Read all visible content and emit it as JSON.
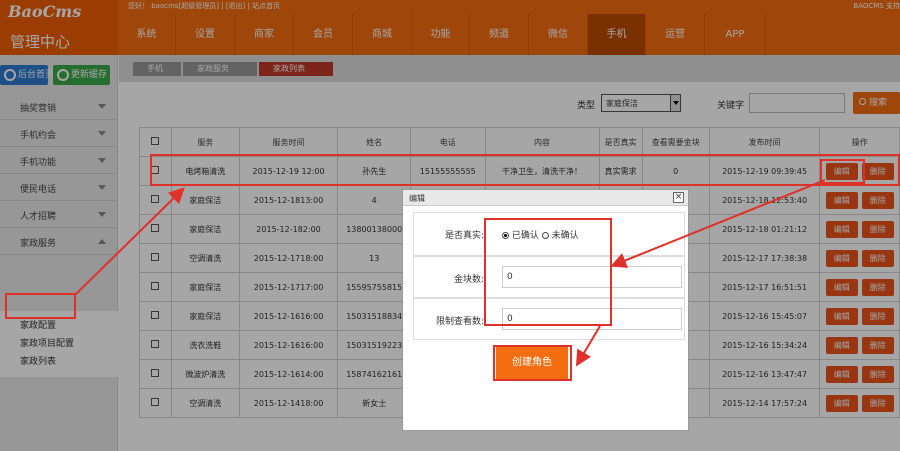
{
  "brand": {
    "logo": "BaoCms",
    "title": "管理中心"
  },
  "top_links": {
    "welcome": "您好！ baocms[超级管理员] | [退出] | 站点首页",
    "support": "BAOCMS 支持"
  },
  "nav": {
    "items": [
      {
        "label": "系统"
      },
      {
        "label": "设置"
      },
      {
        "label": "商家"
      },
      {
        "label": "会员"
      },
      {
        "label": "商城"
      },
      {
        "label": "功能"
      },
      {
        "label": "频道"
      },
      {
        "label": "微信"
      },
      {
        "label": "手机"
      },
      {
        "label": "运营"
      },
      {
        "label": "APP"
      }
    ],
    "active": 8
  },
  "sidebar": {
    "home_button": "后台首页",
    "cache_button": "更新缓存",
    "menu": [
      {
        "label": "抽奖营销"
      },
      {
        "label": "手机约会"
      },
      {
        "label": "手机功能"
      },
      {
        "label": "便民电话"
      },
      {
        "label": "人才招聘"
      },
      {
        "label": "家政服务"
      }
    ],
    "submenu": [
      {
        "label": "家政配置"
      },
      {
        "label": "家政项目配置"
      },
      {
        "label": "家政列表"
      }
    ]
  },
  "breadcrumb": [
    "手机",
    "家政服务",
    "家政列表"
  ],
  "filter": {
    "type_label": "类型",
    "type_value": "家庭保洁",
    "keyword_label": "关键字",
    "search_button": "搜索"
  },
  "table": {
    "headers": [
      "",
      "服务",
      "服务时间",
      "姓名",
      "电话",
      "内容",
      "是否真实",
      "查看需要金块",
      "发布时间",
      "操作"
    ],
    "rows": [
      [
        "电烤箱清洗",
        "2015-12-19 12:00",
        "孙先生",
        "15155555555",
        "干净卫生，清洗干净！",
        "真实需求",
        "0",
        "2015-12-19 09:39:45"
      ],
      [
        "家庭保洁",
        "2015-12-1813:00",
        "4",
        "",
        "",
        "",
        "",
        "2015-12-18 12:53:40"
      ],
      [
        "家庭保洁",
        "2015-12-182:00",
        "13800138000",
        "",
        "",
        "",
        "",
        "2015-12-18 01:21:12"
      ],
      [
        "空调清洗",
        "2015-12-1718:00",
        "13",
        "",
        "",
        "",
        "",
        "2015-12-17 17:38:38"
      ],
      [
        "家庭保洁",
        "2015-12-1717:00",
        "15595755815",
        "",
        "",
        "",
        "",
        "2015-12-17 16:51:51"
      ],
      [
        "家庭保洁",
        "2015-12-1616:00",
        "15031518834",
        "",
        "",
        "",
        "",
        "2015-12-16 15:45:07"
      ],
      [
        "洗衣洗鞋",
        "2015-12-1616:00",
        "15031519223",
        "",
        "",
        "",
        "",
        "2015-12-16 15:34:24"
      ],
      [
        "微波炉清洗",
        "2015-12-1614:00",
        "15874162161",
        "",
        "",
        "",
        "",
        "2015-12-16 13:47:47"
      ],
      [
        "空调清洗",
        "2015-12-1418:00",
        "新女士",
        "",
        "",
        "",
        "",
        "2015-12-14 17:57:24"
      ]
    ],
    "edit_label": "编辑",
    "delete_label": "删除"
  },
  "dialog": {
    "title": "编辑",
    "close": "×",
    "real_label": "是否真实:",
    "radio_confirmed": "已确认",
    "radio_unconfirmed": "未确认",
    "gold_label": "金块数:",
    "gold_value": "0",
    "limit_label": "限制查看数:",
    "limit_value": "0",
    "create_button": "创建角色"
  },
  "colors": {
    "brand_orange": "#f46d10",
    "active_nav": "#be4b00",
    "annotation_red": "#e0302a"
  }
}
